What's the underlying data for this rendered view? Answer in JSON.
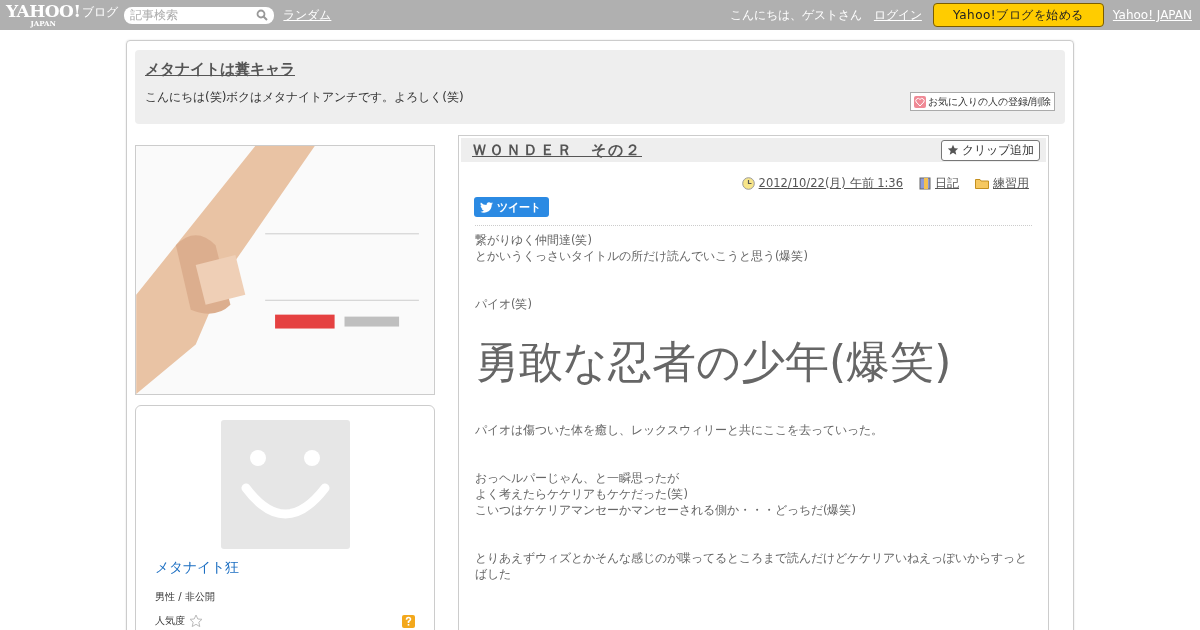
{
  "topbar": {
    "logo": "YAHOO!",
    "logo_sub": "JAPAN",
    "logo_suffix": "ブログ",
    "search": {
      "placeholder": "記事検索"
    },
    "random_link": "ランダム",
    "greeting": "こんにちは、ゲストさん",
    "login": "ログイン",
    "start_button": "Yahoo!ブログを始める",
    "yahoo_link": "Yahoo! JAPAN"
  },
  "blog_header": {
    "title": "メタナイトは糞キャラ",
    "description": "こんにちは(笑)ボクはメタナイトアンチです。よろしく(笑)",
    "favorite_button": "お気に入りの人の登録/削除"
  },
  "sidebar": {
    "profile": {
      "name": "メタナイト狂",
      "info": "男性 / 非公開",
      "popularity_label": "人気度"
    }
  },
  "article": {
    "title": "ＷＯＮＤＥＲ　その２",
    "clip_button": "クリップ追加",
    "date": "2012/10/22(月) 午前 1:36",
    "category": "日記",
    "folder": "練習用",
    "tweet_button": "ツイート",
    "body": [
      {
        "kind": "text",
        "lines": [
          "繋がりゆく仲間達(笑)",
          "とかいうくっさいタイトルの所だけ読んでいこうと思う(爆笑)"
        ]
      },
      {
        "kind": "text",
        "lines": [
          "パイオ(笑)"
        ]
      },
      {
        "kind": "large",
        "lines": [
          "勇敢な忍者の少年(爆笑)"
        ]
      },
      {
        "kind": "text",
        "lines": [
          "パイオは傷ついた体を癒し、レックスウィリーと共にここを去っていった。"
        ]
      },
      {
        "kind": "text",
        "lines": [
          "おっヘルパーじゃん、と一瞬思ったが",
          "よく考えたらケケリアもケケだった(笑)",
          "こいつはケケリアマンセーかマンセーされる側か・・・どっちだ(爆笑)"
        ]
      },
      {
        "kind": "text",
        "lines": [
          "とりあえずウィズとかそんな感じのが喋ってるところまで読んだけどケケリアいねえっぽいからすっとばした"
        ]
      }
    ]
  }
}
